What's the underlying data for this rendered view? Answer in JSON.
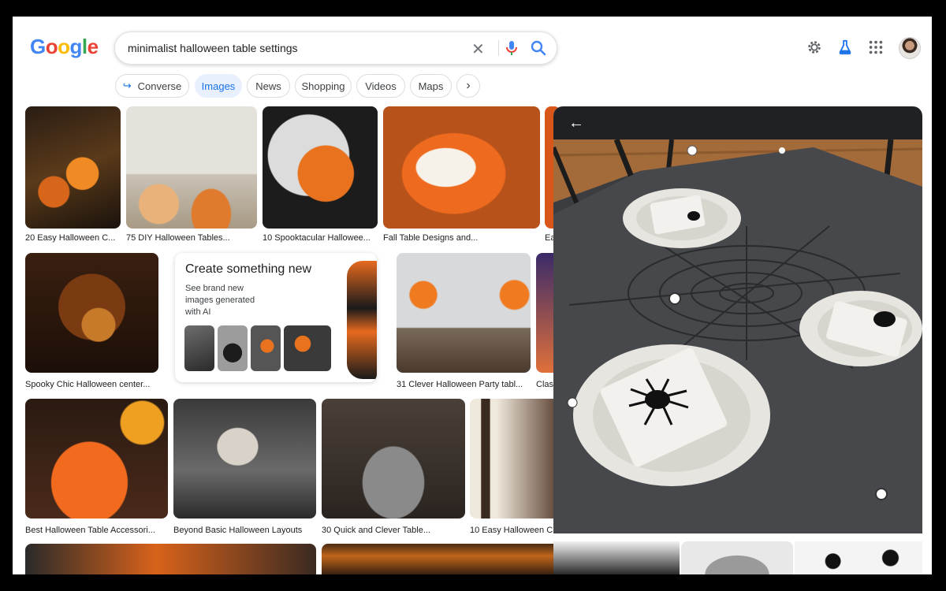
{
  "logo": [
    "G",
    "o",
    "o",
    "g",
    "l",
    "e"
  ],
  "search": {
    "query": "minimalist halloween table settings"
  },
  "chips": [
    "Converse",
    "Images",
    "News",
    "Shopping",
    "Videos",
    "Maps"
  ],
  "results": [
    {
      "caption": "20 Easy Halloween C..."
    },
    {
      "caption": "75 DIY Halloween Tables..."
    },
    {
      "caption": "10 Spooktacular Hallowee..."
    },
    {
      "caption": "Fall Table Designs and..."
    },
    {
      "caption": "Ea"
    },
    {
      "caption": "Spooky Chic Halloween center..."
    },
    {
      "caption": "31 Clever Halloween Party tabl..."
    },
    {
      "caption": "Clas"
    },
    {
      "caption": "Best Halloween Table Accessori..."
    },
    {
      "caption": "Beyond Basic Halloween Layouts"
    },
    {
      "caption": "30 Quick and Clever Table..."
    },
    {
      "caption": "10 Easy Halloween C"
    }
  ],
  "create": {
    "title": "Create something new",
    "subtitle": "See brand new images generated with AI"
  },
  "colors": {
    "accent": "#1a73e8",
    "chip_active_bg": "#e8f0fe",
    "panel_bar": "#202124",
    "halloween_orange": "#e8651f"
  }
}
